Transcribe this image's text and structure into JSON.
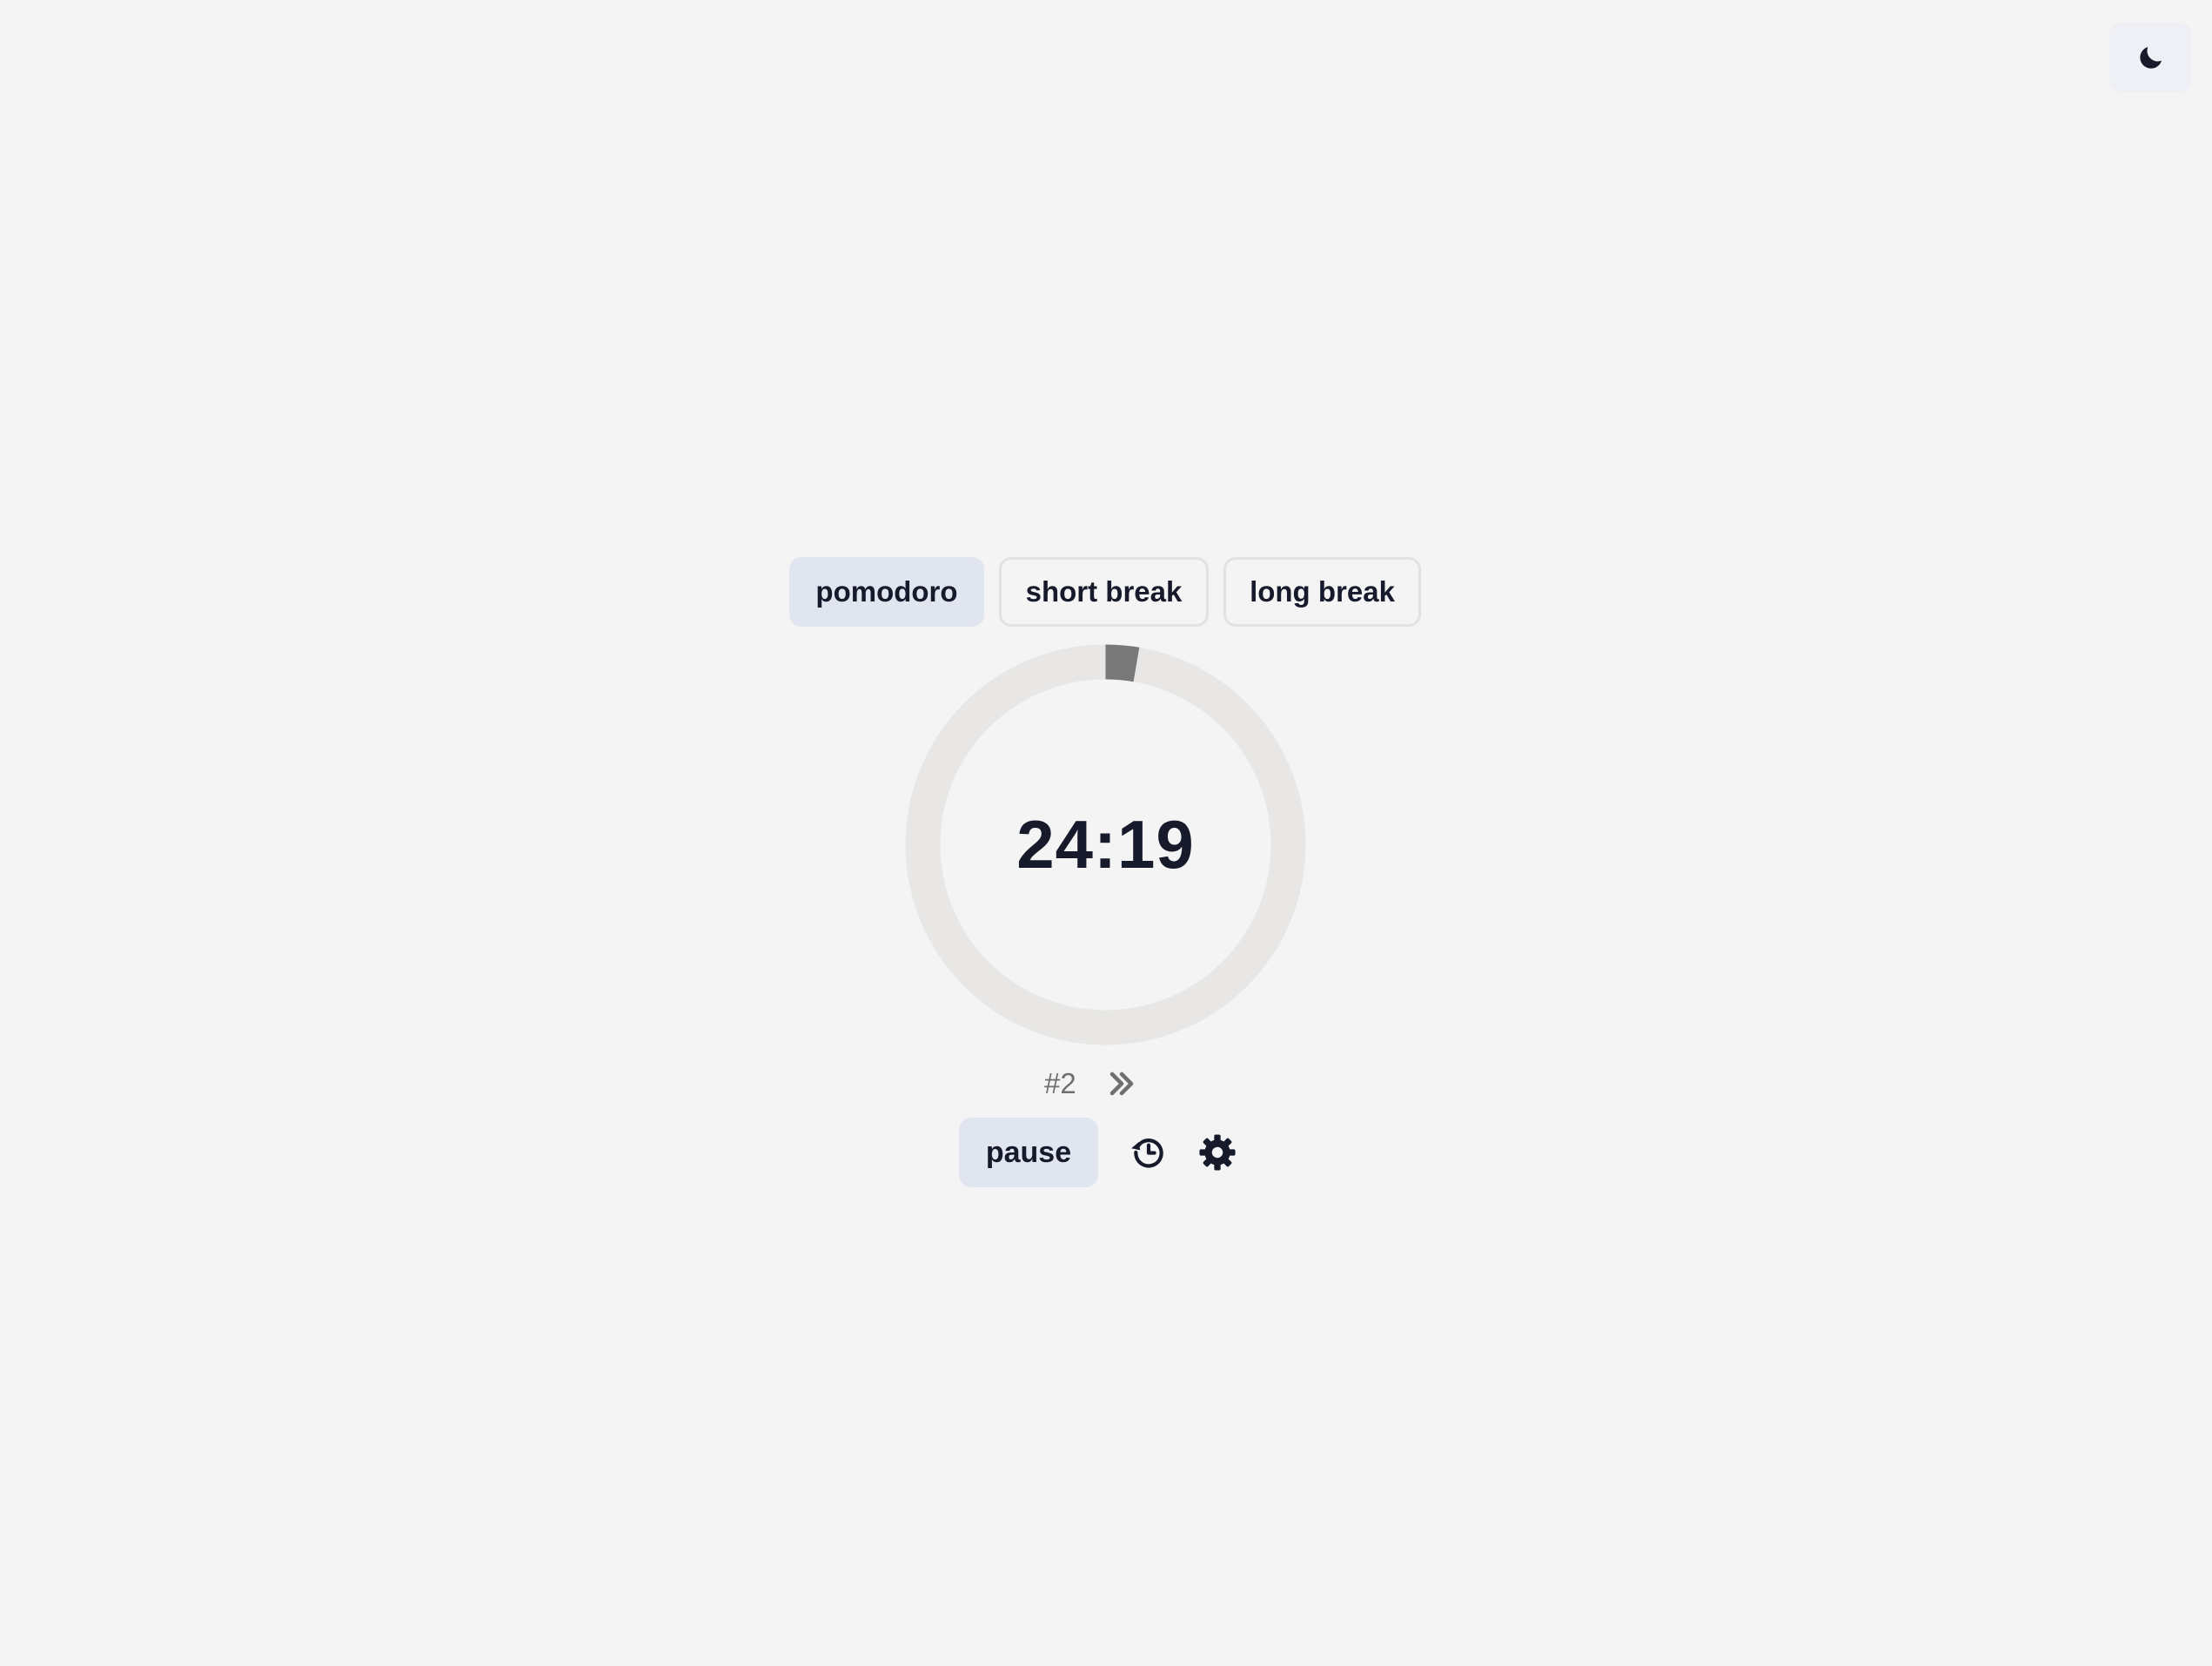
{
  "theme_toggle": {
    "icon": "moon-icon"
  },
  "modes": [
    {
      "label": "pomodoro",
      "active": true
    },
    {
      "label": "short break",
      "active": false
    },
    {
      "label": "long break",
      "active": false
    }
  ],
  "timer": {
    "display": "24:19",
    "progress": 0.027,
    "colors": {
      "track": "#e8e7e5",
      "progress": "#787878"
    }
  },
  "session": {
    "count": "#2",
    "skip_icon": "double-chevron-right-icon"
  },
  "controls": {
    "pause_label": "pause",
    "history_icon": "history-icon",
    "settings_icon": "gear-icon"
  },
  "colors": {
    "background": "#f4f4f4",
    "accent_button": "#e1e5ef",
    "text": "#161a2b"
  }
}
